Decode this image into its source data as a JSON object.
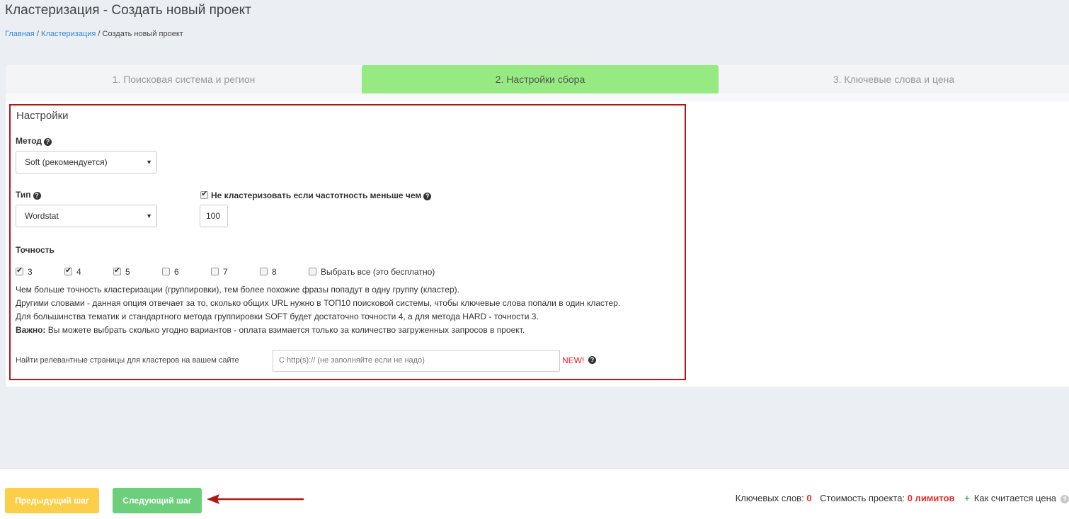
{
  "page": {
    "title": "Кластеризация - Создать новый проект"
  },
  "breadcrumb": {
    "home": "Главная",
    "sep1": " / ",
    "section": "Кластеризация",
    "sep2": " / ",
    "current": "Создать новый проект"
  },
  "tabs": [
    {
      "label": "1. Поисковая система и регион",
      "active": false
    },
    {
      "label": "2. Настройки сбора",
      "active": true
    },
    {
      "label": "3. Ключевые слова и цена",
      "active": false
    }
  ],
  "settings": {
    "title": "Настройки",
    "method": {
      "label": "Метод",
      "selected": "Soft (рекомендуется)"
    },
    "type": {
      "label": "Тип",
      "selected": "Wordstat"
    },
    "threshold": {
      "label": "Не кластеризовать если частотность меньше чем",
      "checked": true,
      "value": "100"
    },
    "precision": {
      "label": "Точность",
      "options": [
        {
          "label": "3",
          "checked": true
        },
        {
          "label": "4",
          "checked": true
        },
        {
          "label": "5",
          "checked": true
        },
        {
          "label": "6",
          "checked": false
        },
        {
          "label": "7",
          "checked": false
        },
        {
          "label": "8",
          "checked": false
        }
      ],
      "select_all": {
        "label": "Выбрать все (это бесплатно)",
        "checked": false
      }
    },
    "description": {
      "line1": "Чем больше точность кластеризации (группировки), тем более похожие фразы попадут в одну группу (кластер).",
      "line2": "Другими словами - данная опция отвечает за то, сколько общих URL нужно в ТОП10 поисковой системы, чтобы ключевые слова попали в один кластер.",
      "line3": "Для большинства тематик и стандартного метода группировки SOFT будет достаточно точности 4, а для метода HARD - точности 3.",
      "important_label": "Важно:",
      "important_text": " Вы можете выбрать сколько угодно вариантов - оплата взимается только за количество загруженных запросов в проект."
    },
    "relevant": {
      "label": "Найти релевантные страницы для кластеров на вашем сайте",
      "placeholder": "С http(s):// (не заполняйте если не надо)",
      "badge": "NEW!"
    }
  },
  "footer": {
    "prev_label": "Предыдущий шаг",
    "next_label": "Следующий шаг",
    "keywords_label": "Ключевых слов:",
    "keywords_value": "0",
    "cost_label": "Стоимость проекта:",
    "cost_value": "0 лимитов",
    "how_label": "Как считается цена",
    "plus": "+"
  },
  "colors": {
    "active_tab": "#96ea81",
    "prev_button": "#fcce4a",
    "next_button": "#6ccf7c",
    "highlight_border": "#b01818",
    "arrow": "#b01818"
  }
}
